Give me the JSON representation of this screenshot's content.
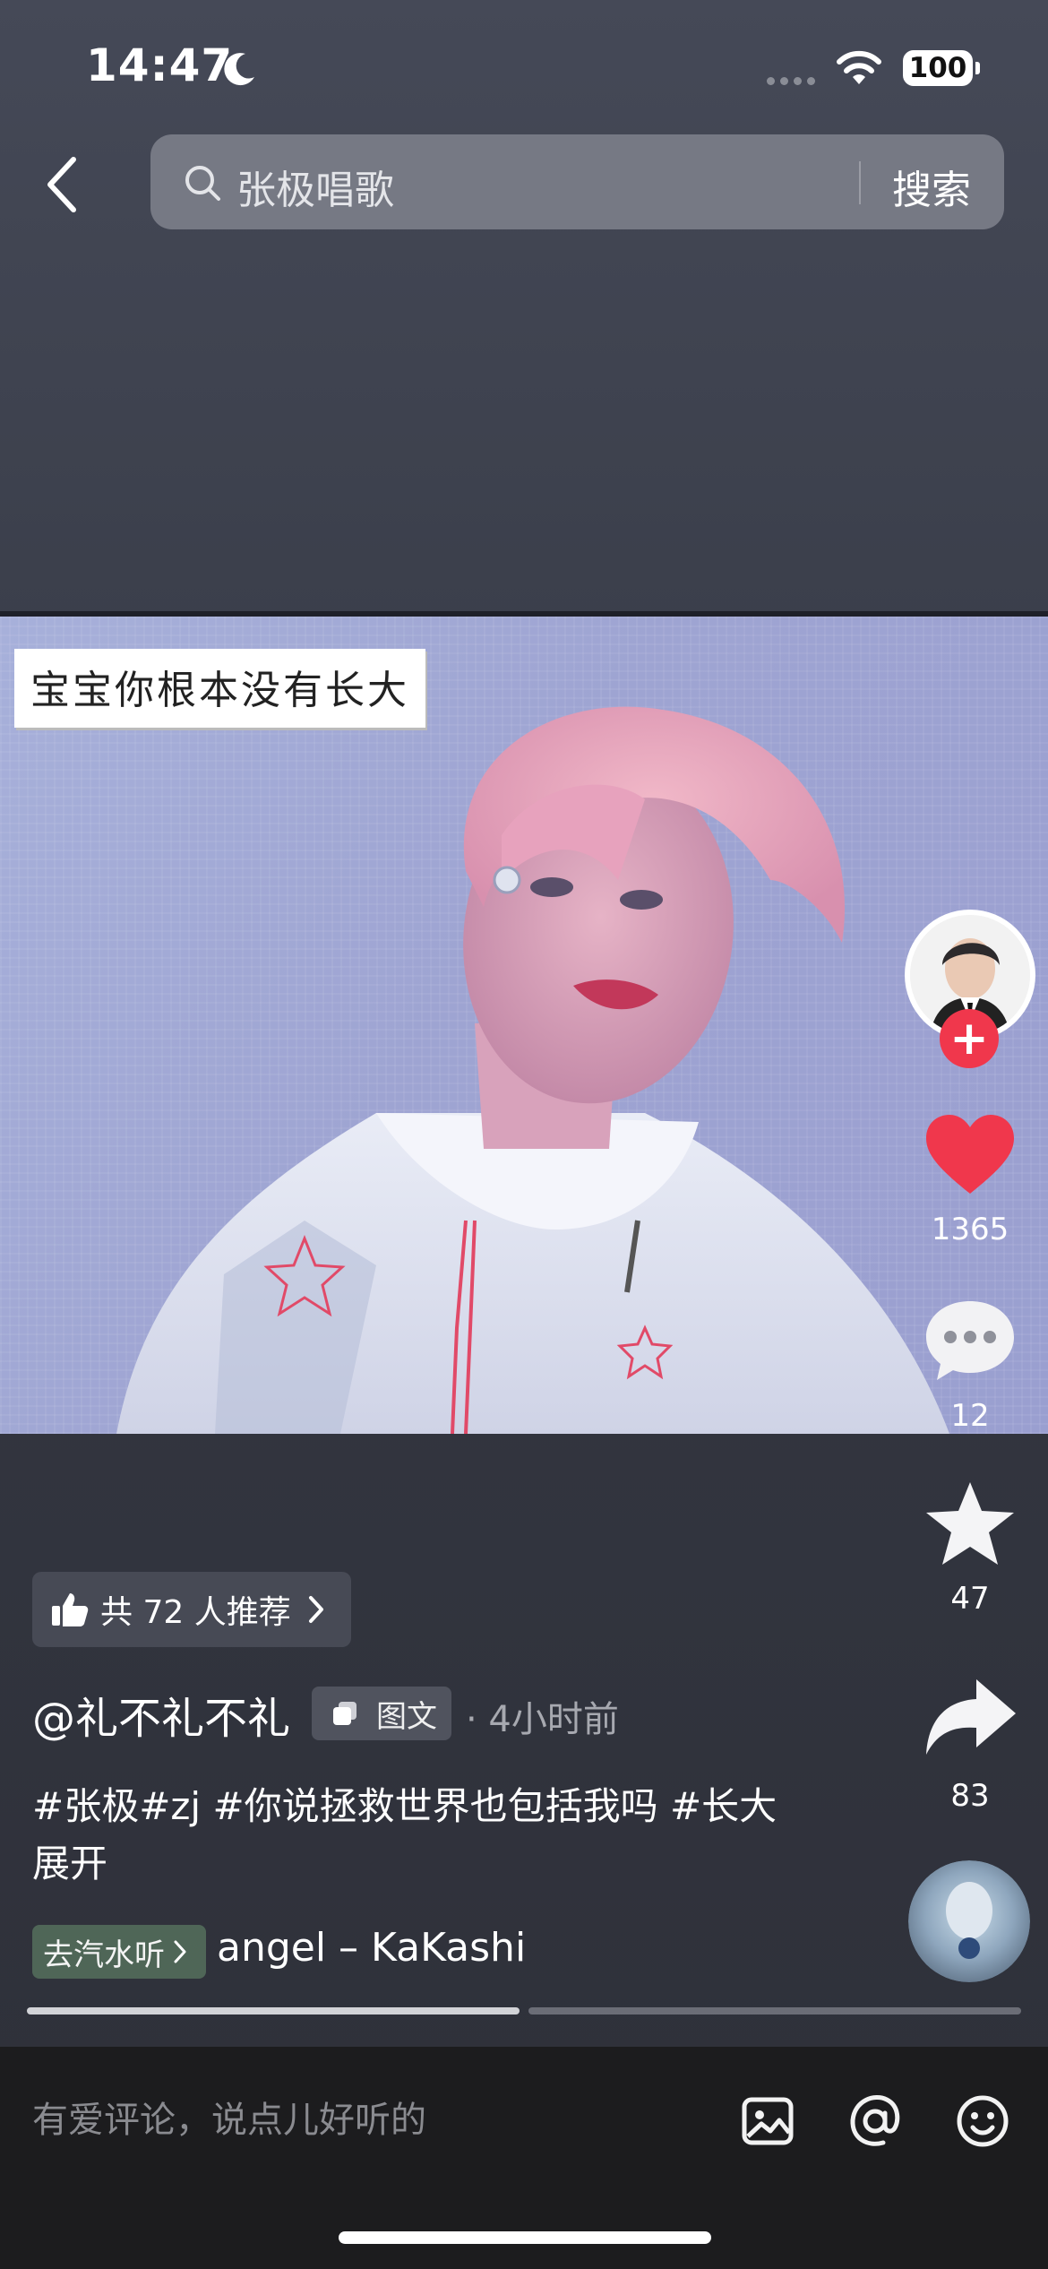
{
  "status_bar": {
    "time": "14:47",
    "battery": "100",
    "icons": [
      "moon-icon",
      "signal-icon",
      "wifi-icon",
      "battery-icon"
    ]
  },
  "header": {
    "search_query": "张极唱歌",
    "search_button": "搜索",
    "icons": [
      "back-arrow-icon",
      "search-icon"
    ]
  },
  "post": {
    "image_caption": "宝宝你根本没有长大",
    "recommend_label": "共 72 人推荐",
    "author": "@礼不礼不礼",
    "type_tag": "图文",
    "time_ago": "· 4小时前",
    "hashtags": "#张极#zj #你说拯救世界也包括我吗 #长大",
    "expand_label": "展开",
    "music_button": "去汽水听",
    "music_title": "angel – KaKashi",
    "image_count": 2,
    "current_image": 1
  },
  "actions": {
    "likes": "1365",
    "comments": "12",
    "favorites": "47",
    "shares": "83"
  },
  "comment_bar": {
    "placeholder": "有爱评论，说点儿好听的",
    "icons": [
      "image-icon",
      "at-icon",
      "emoji-icon"
    ]
  },
  "colors": {
    "like": "#f0374c",
    "follow": "#f0374c",
    "background": "#3a3e4a",
    "bottom_bar": "#1c1c1e",
    "music_pill": "#4f6657"
  }
}
